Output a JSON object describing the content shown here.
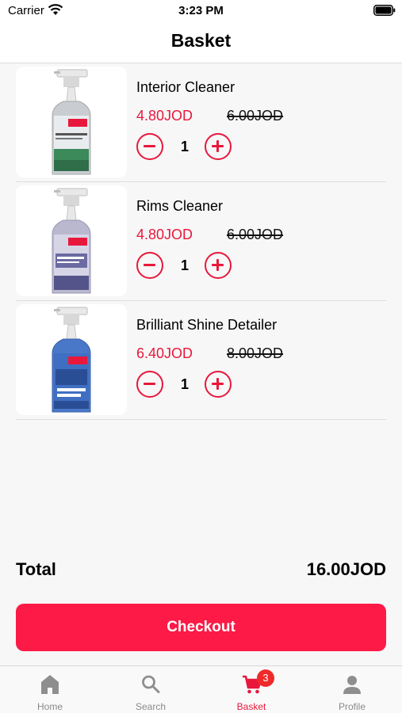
{
  "status_bar": {
    "carrier": "Carrier",
    "time": "3:23 PM"
  },
  "nav": {
    "title": "Basket"
  },
  "items": [
    {
      "name": "Interior Cleaner",
      "price": "4.80JOD",
      "old_price": "6.00JOD",
      "qty": "1",
      "image_icon": "spray-bottle-green"
    },
    {
      "name": "Rims Cleaner",
      "price": "4.80JOD",
      "old_price": "6.00JOD",
      "qty": "1",
      "image_icon": "spray-bottle-purple"
    },
    {
      "name": "Brilliant Shine Detailer",
      "price": "6.40JOD",
      "old_price": "8.00JOD",
      "qty": "1",
      "image_icon": "spray-bottle-blue"
    }
  ],
  "summary": {
    "total_label": "Total",
    "total_value": "16.00JOD"
  },
  "checkout": {
    "label": "Checkout"
  },
  "tabs": [
    {
      "label": "Home",
      "icon": "home-icon"
    },
    {
      "label": "Search",
      "icon": "search-icon"
    },
    {
      "label": "Basket",
      "icon": "cart-icon",
      "badge": "3",
      "active": true
    },
    {
      "label": "Profile",
      "icon": "profile-icon"
    }
  ],
  "colors": {
    "accent": "#e8183c",
    "checkout_bg": "#fd1a46",
    "badge": "#ee2a2a"
  }
}
